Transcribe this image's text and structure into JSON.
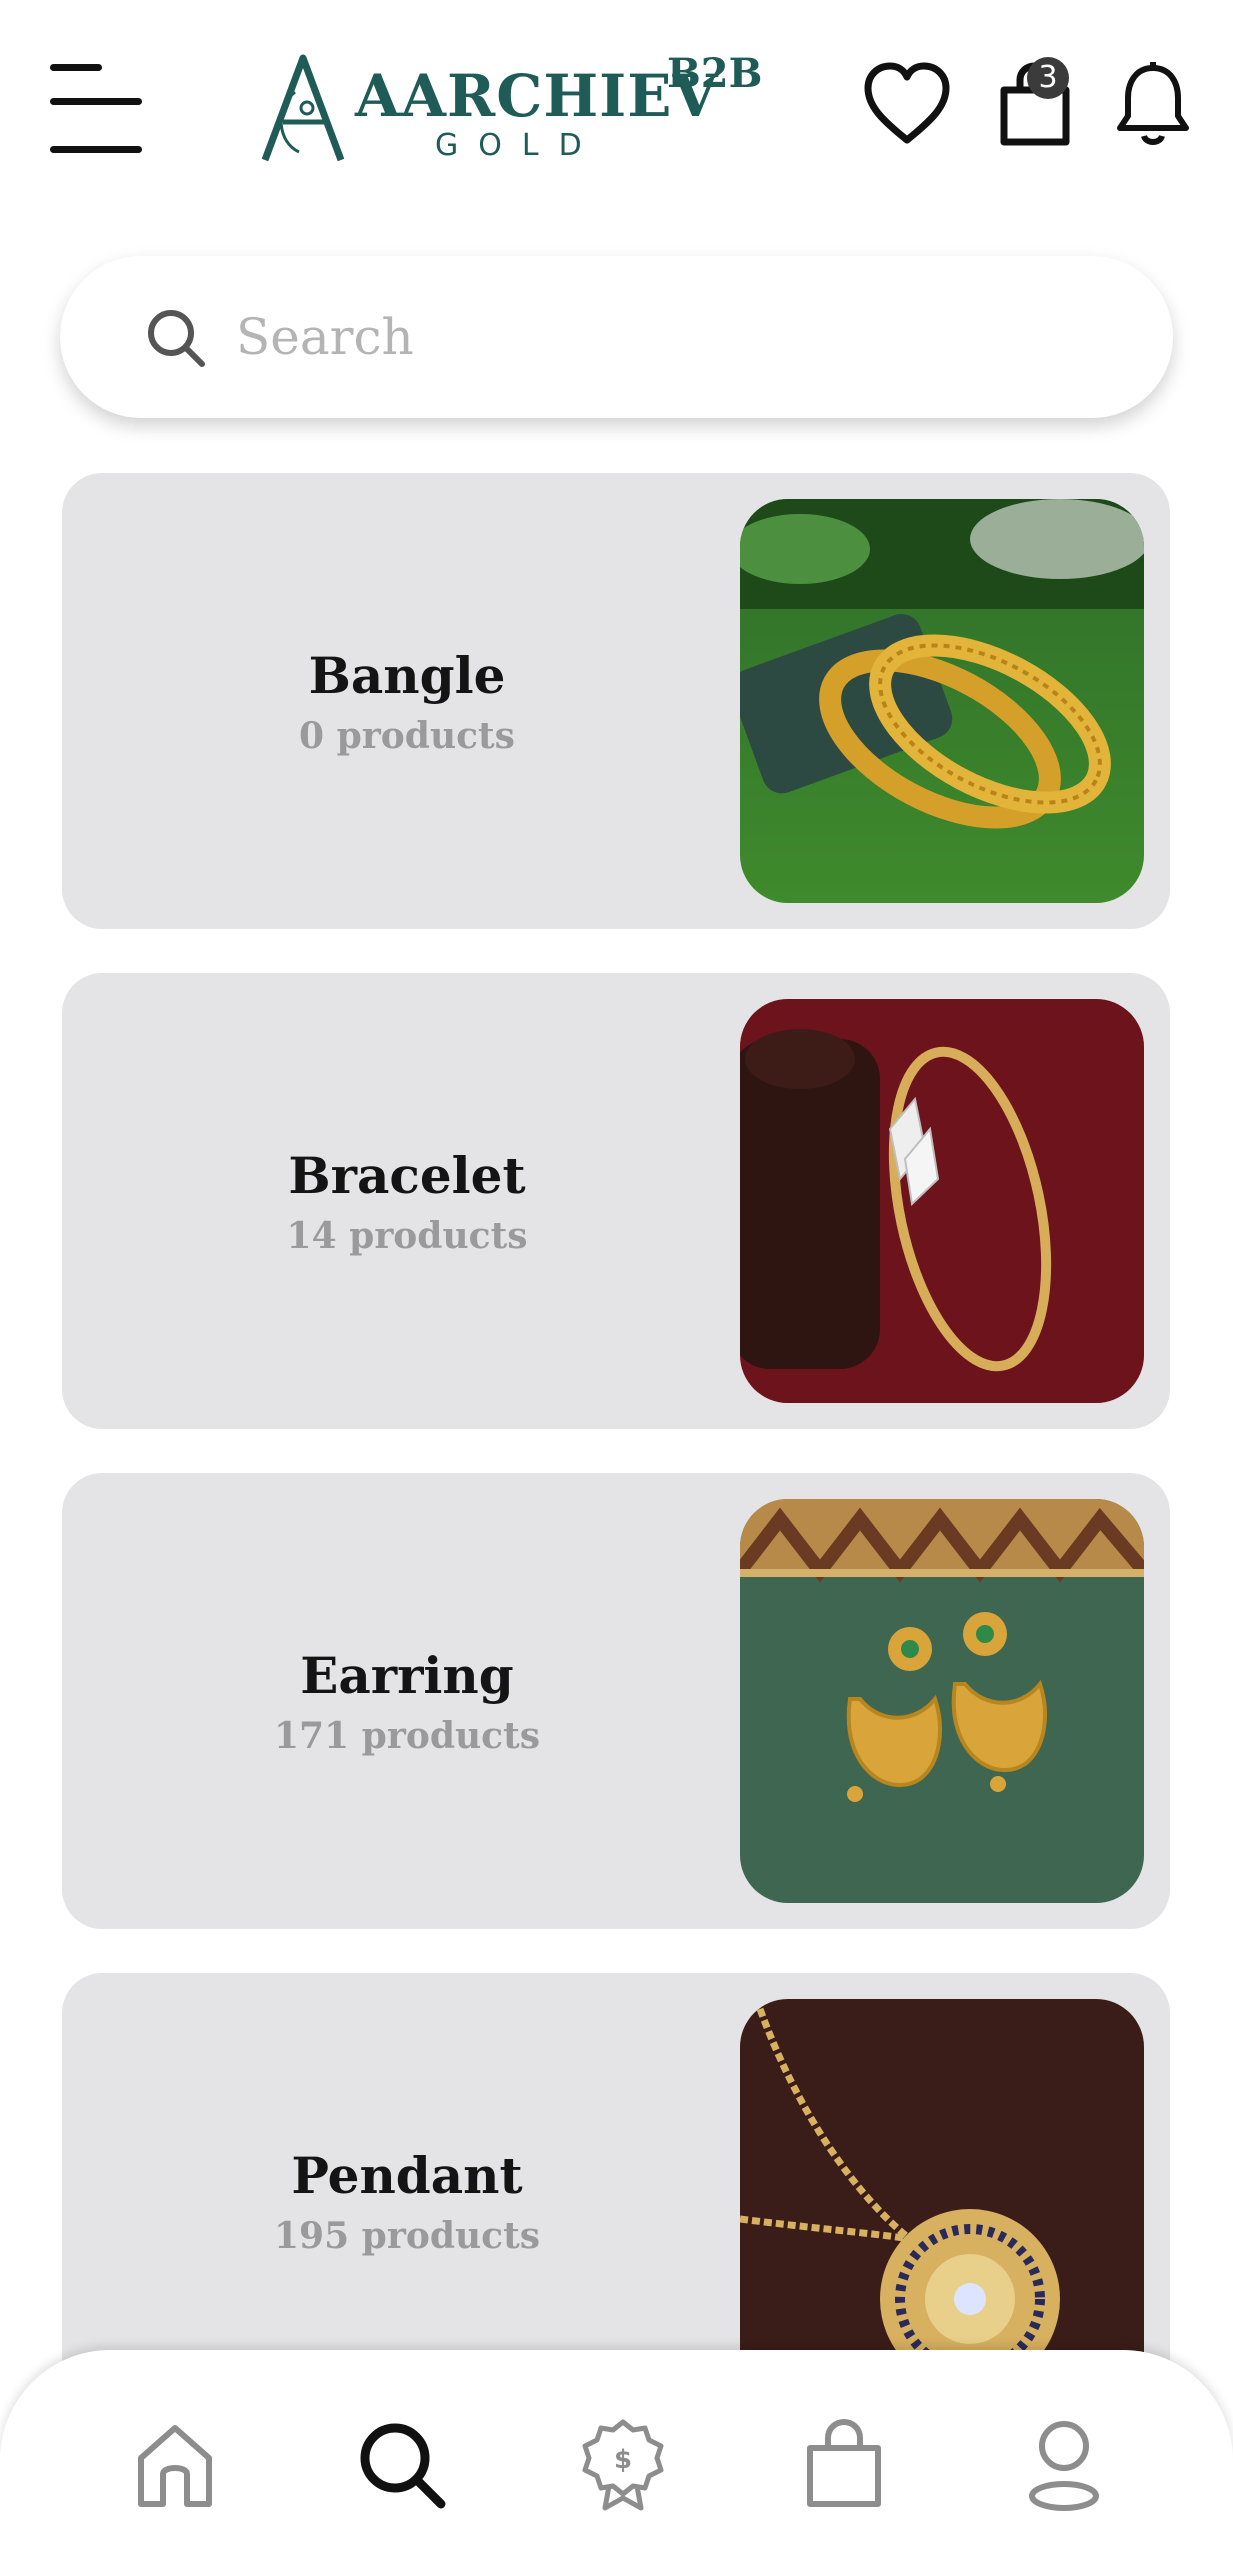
{
  "header": {
    "brand_name": "AARCHIEV",
    "brand_tag": "B2B",
    "brand_sub": "GOLD",
    "cart_count": "3",
    "icons": [
      "menu-icon",
      "heart-icon",
      "shopping-bag-icon",
      "bell-icon"
    ]
  },
  "search": {
    "placeholder": "Search",
    "value": ""
  },
  "categories": [
    {
      "name": "Bangle",
      "count": "0 products"
    },
    {
      "name": "Bracelet",
      "count": "14 products"
    },
    {
      "name": "Earring",
      "count": "171 products"
    },
    {
      "name": "Pendant",
      "count": "195 products"
    }
  ],
  "bottom_nav": {
    "items": [
      "home-icon",
      "search-icon",
      "offers-badge-icon",
      "shopping-bag-icon",
      "profile-icon"
    ],
    "active": "search-icon"
  },
  "colors": {
    "brand_teal": "#1f5b57",
    "card_bg": "#e4e3e5",
    "muted_text": "#9a9a9c",
    "badge_bg": "#3b3b3b"
  }
}
